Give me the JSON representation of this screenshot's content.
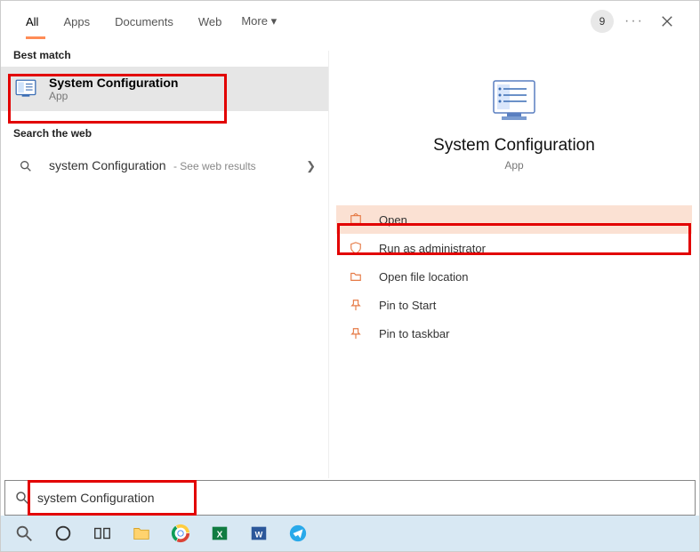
{
  "tabs": {
    "all": "All",
    "apps": "Apps",
    "documents": "Documents",
    "web": "Web",
    "more": "More"
  },
  "top_right": {
    "badge": "9"
  },
  "sections": {
    "best_match": "Best match",
    "search_web": "Search the web"
  },
  "best_match_result": {
    "title": "System Configuration",
    "subtitle": "App"
  },
  "web_result": {
    "query": "system Configuration",
    "suffix": "- See web results"
  },
  "preview": {
    "title": "System Configuration",
    "subtitle": "App"
  },
  "actions": {
    "open": "Open",
    "run_admin": "Run as administrator",
    "open_location": "Open file location",
    "pin_start": "Pin to Start",
    "pin_taskbar": "Pin to taskbar"
  },
  "search_bar": {
    "value": "system Configuration"
  }
}
